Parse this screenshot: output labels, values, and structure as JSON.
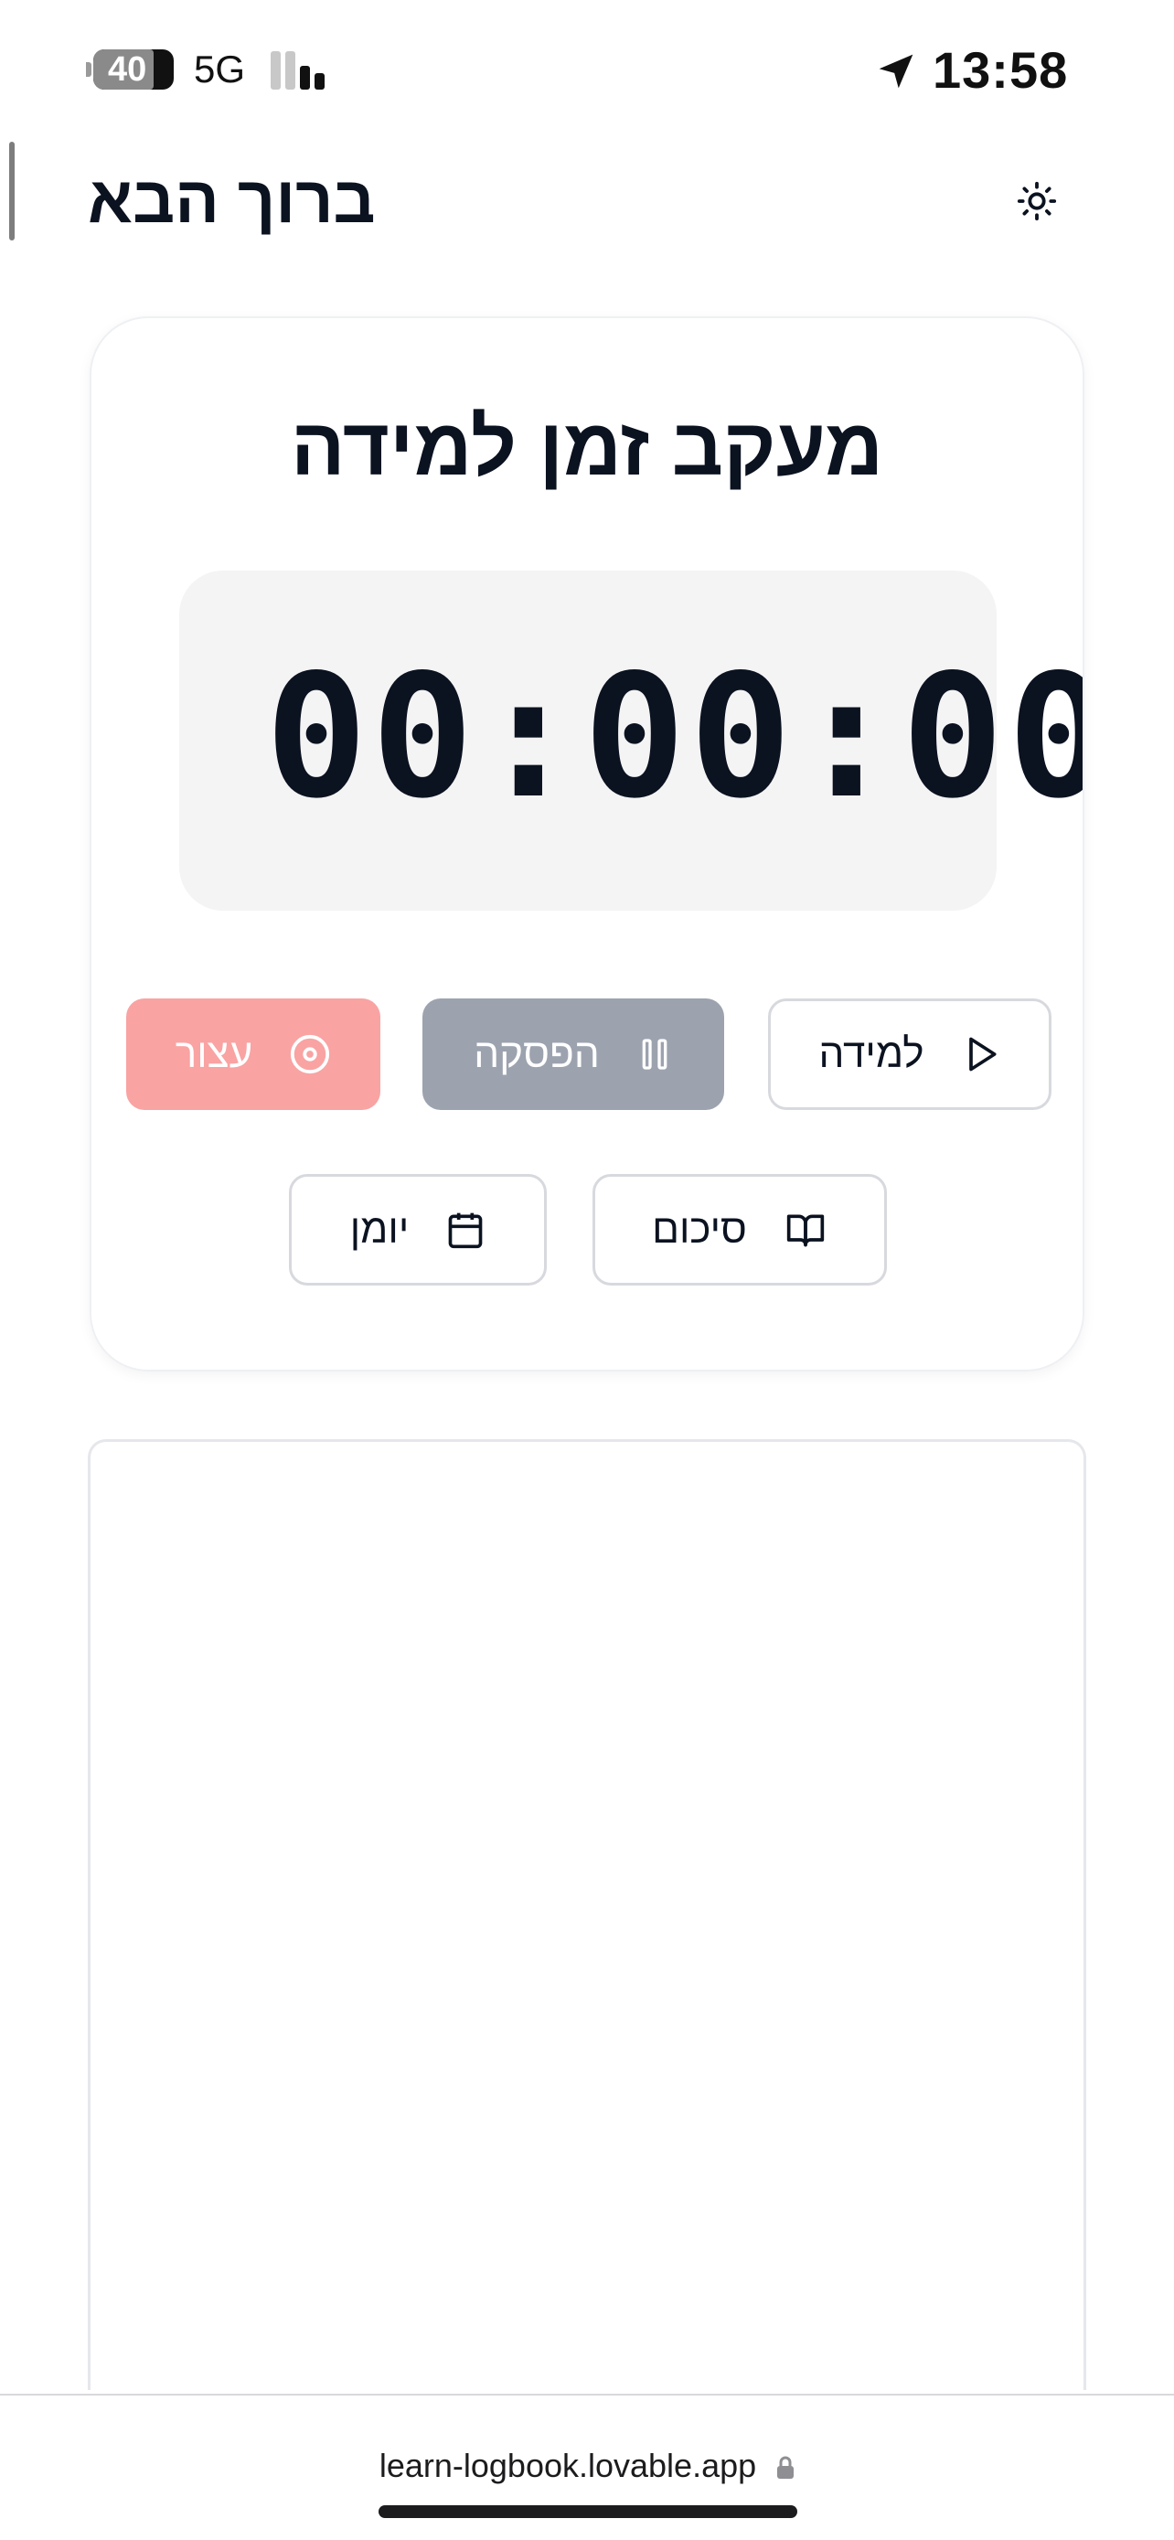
{
  "status_bar": {
    "battery": "40",
    "network": "5G",
    "time": "13:58"
  },
  "header": {
    "title": "ברוך הבא",
    "theme_toggle_icon": "sun-icon"
  },
  "timer_card": {
    "title": "מעקב זמן למידה",
    "timer_value": "00:00:00",
    "buttons": {
      "start": {
        "label": "למידה",
        "icon": "play-icon"
      },
      "pause": {
        "label": "הפסקה",
        "icon": "pause-icon"
      },
      "stop": {
        "label": "עצור",
        "icon": "stop-circle-icon"
      },
      "summary": {
        "label": "סיכום",
        "icon": "book-open-icon"
      },
      "journal": {
        "label": "יומן",
        "icon": "calendar-icon"
      }
    }
  },
  "browser": {
    "url": "learn-logbook.lovable.app"
  },
  "colors": {
    "text": "#0b1220",
    "stop_button": "#f9a3a3",
    "pause_button": "#9ca3af",
    "timer_background": "#f4f4f5"
  }
}
